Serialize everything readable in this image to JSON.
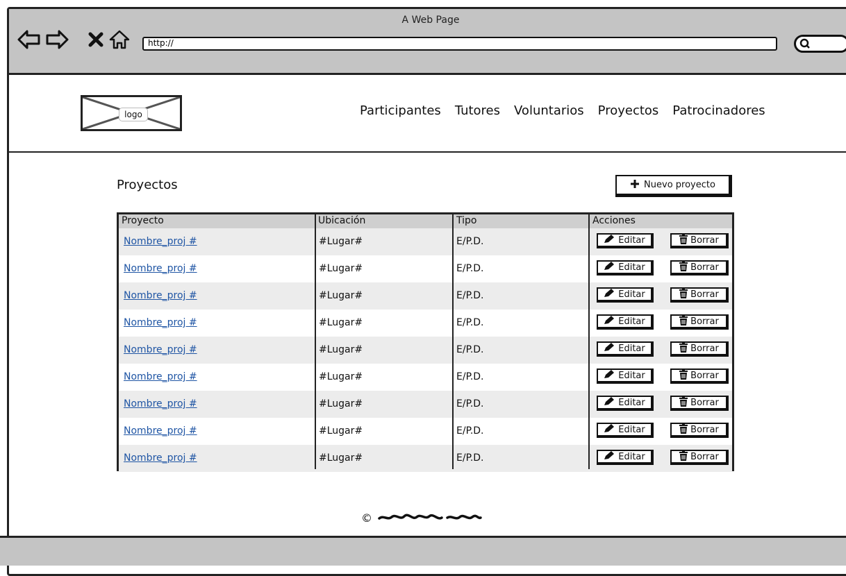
{
  "browser": {
    "title": "A Web Page",
    "url": "http://",
    "icons": {
      "back": "back-arrow-icon",
      "forward": "forward-arrow-icon",
      "stop": "close-icon",
      "home": "home-icon",
      "search": "search-icon"
    }
  },
  "header": {
    "logo_label": "logo",
    "nav": [
      "Participantes",
      "Tutores",
      "Voluntarios",
      "Proyectos",
      "Patrocinadores"
    ]
  },
  "main": {
    "title": "Proyectos",
    "new_button": "Nuevo proyecto",
    "table": {
      "columns": [
        "Proyecto",
        "Ubicación",
        "Tipo",
        "Acciones"
      ],
      "rows": [
        {
          "name": "Nombre_proj #",
          "location": "#Lugar#",
          "type": "E/P.D."
        },
        {
          "name": "Nombre_proj #",
          "location": "#Lugar#",
          "type": "E/P.D."
        },
        {
          "name": "Nombre_proj #",
          "location": "#Lugar#",
          "type": "E/P.D."
        },
        {
          "name": "Nombre_proj #",
          "location": "#Lugar#",
          "type": "E/P.D."
        },
        {
          "name": "Nombre_proj #",
          "location": "#Lugar#",
          "type": "E/P.D."
        },
        {
          "name": "Nombre_proj #",
          "location": "#Lugar#",
          "type": "E/P.D."
        },
        {
          "name": "Nombre_proj #",
          "location": "#Lugar#",
          "type": "E/P.D."
        },
        {
          "name": "Nombre_proj #",
          "location": "#Lugar#",
          "type": "E/P.D."
        },
        {
          "name": "Nombre_proj #",
          "location": "#Lugar#",
          "type": "E/P.D."
        }
      ],
      "edit_label": "Editar",
      "delete_label": "Borrar"
    }
  },
  "footer": {
    "copyright_symbol": "©"
  },
  "colors": {
    "chrome": "#c4c4c4",
    "link": "#1f55a4",
    "header_row": "#cfcfcf",
    "alt_row": "#ececec"
  }
}
